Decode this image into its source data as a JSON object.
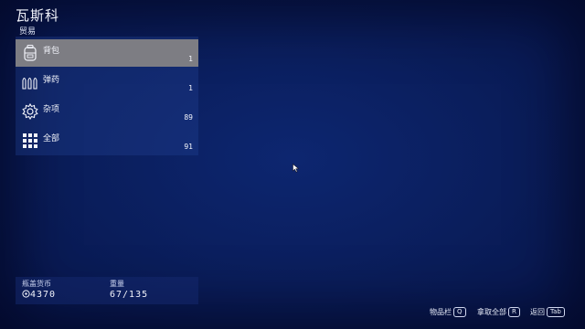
{
  "trader_name": "瓦斯科",
  "subtitle": "贸易",
  "categories": [
    {
      "label": "背包",
      "count": "1",
      "icon": "backpack-icon",
      "selected": true
    },
    {
      "label": "弹药",
      "count": "1",
      "icon": "ammo-icon",
      "selected": false
    },
    {
      "label": "杂项",
      "count": "89",
      "icon": "gear-icon",
      "selected": false
    },
    {
      "label": "全部",
      "count": "91",
      "icon": "grid-icon",
      "selected": false
    }
  ],
  "player_info": {
    "currency_label": "瓶盖货币",
    "currency_value": "4370",
    "weight_label": "重量",
    "weight_value": "67/135"
  },
  "hints": {
    "transfer_label": "物品栏",
    "transfer_key": "Q",
    "take_all_label": "拿取全部",
    "take_all_key": "R",
    "back_label": "返回",
    "back_key": "Tab"
  }
}
